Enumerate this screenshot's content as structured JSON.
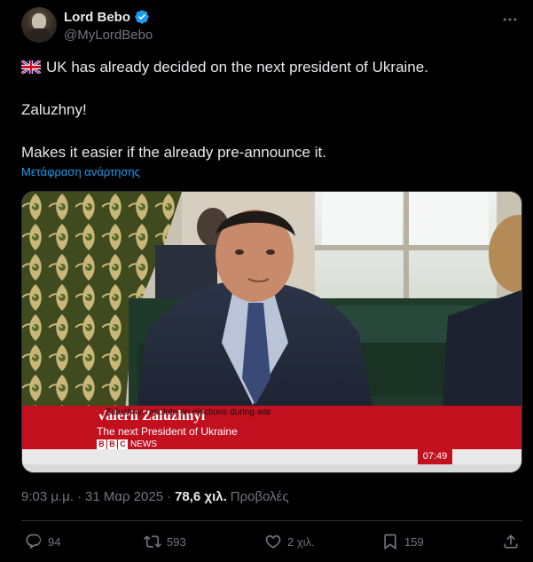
{
  "author": {
    "display_name": "Lord Bebo",
    "handle": "@MyLordBebo"
  },
  "post": {
    "line1": "UK has already decided on the next president of Ukraine.",
    "line2": "Zaluzhny!",
    "line3": "Makes it easier if the already pre-announce it.",
    "translate_link": "Μετάφραση ανάρτησης"
  },
  "media": {
    "caption_name": "Valerii Zaluzhnyi",
    "caption_title": "The next President of Ukraine",
    "broadcaster": "BBC",
    "broadcaster_suffix": "NEWS",
    "ticker": "Zaluzhnyi resolute on elections during war",
    "clock": "07:49"
  },
  "meta": {
    "time": "9:03 μ.μ.",
    "separator1": "·",
    "date": "31 Μαρ 2025",
    "separator2": "·",
    "views_count": "78,6 χιλ.",
    "views_label": "Προβολές"
  },
  "actions": {
    "replies": "94",
    "reposts": "593",
    "likes": "2 χιλ.",
    "bookmarks": "159"
  },
  "colors": {
    "background": "#000000",
    "text_primary": "#e7e9ea",
    "text_secondary": "#71767b",
    "link": "#1d9bf0",
    "verified": "#1d9bf0",
    "bbc_red": "#c3101f"
  },
  "icons": {
    "verified": "verified-badge-icon",
    "more": "more-icon",
    "flag": "uk-flag-icon",
    "reply": "reply-icon",
    "repost": "repost-icon",
    "like": "heart-icon",
    "bookmark": "bookmark-icon",
    "share": "share-icon"
  }
}
